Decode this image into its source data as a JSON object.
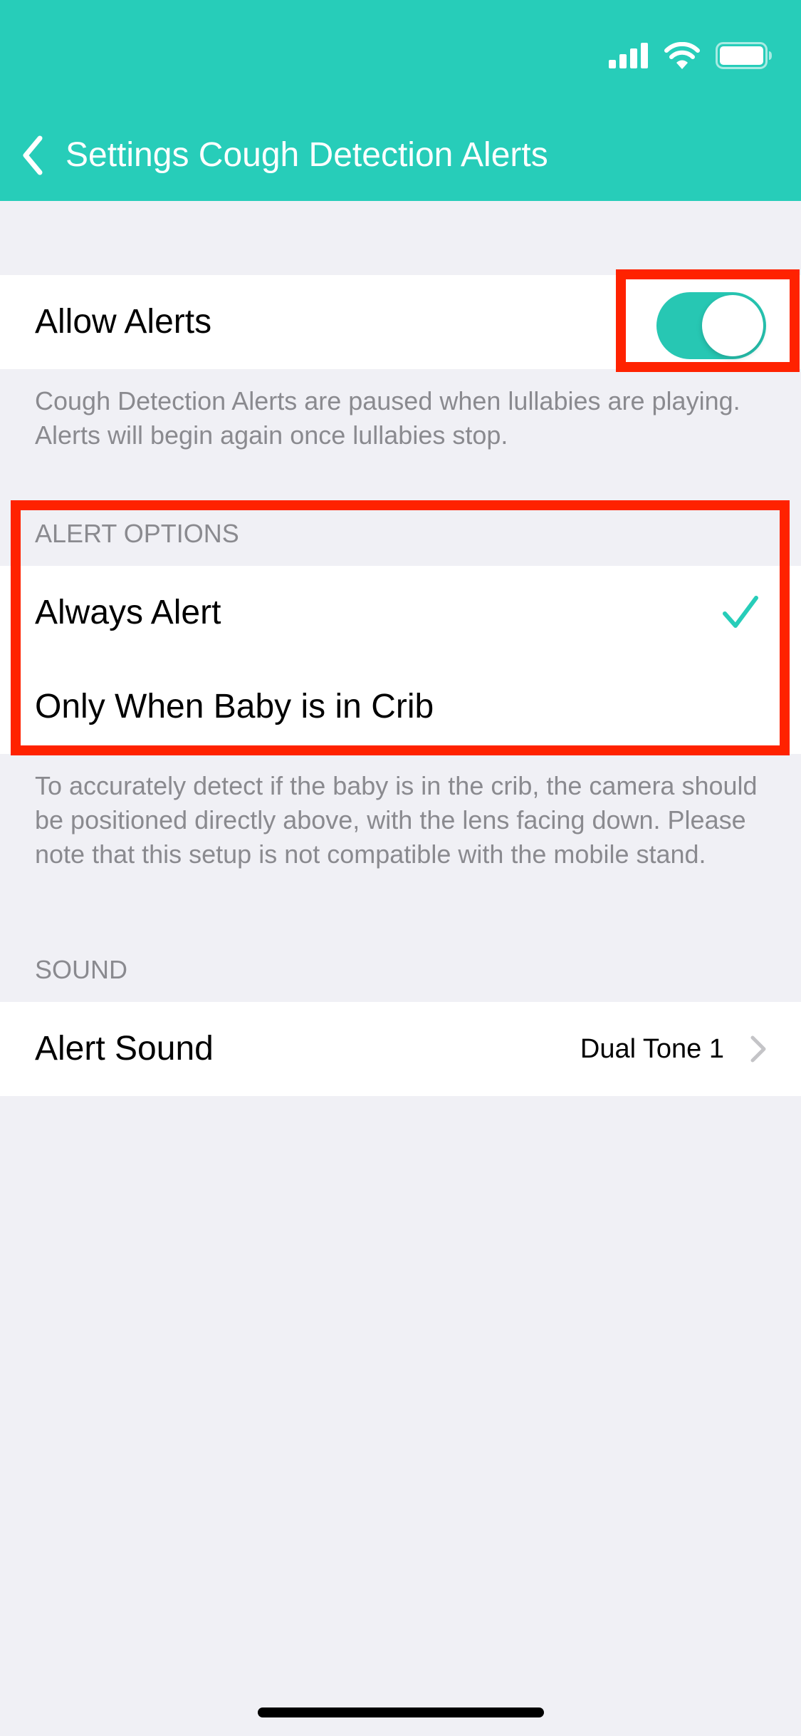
{
  "colors": {
    "accent": "#27CDB9",
    "highlight": "#FF2200",
    "background": "#F0F0F5",
    "secondary_text": "#8A8A8F"
  },
  "status_bar": {
    "icons": [
      "cellular-signal-icon",
      "wifi-icon",
      "battery-icon"
    ]
  },
  "nav": {
    "back_icon": "chevron-left-icon",
    "title": "Settings Cough Detection Alerts"
  },
  "allow_alerts": {
    "label": "Allow Alerts",
    "toggle_on": true,
    "footnote": "Cough Detection Alerts are paused when lullabies are playing. Alerts will begin again once lullabies stop."
  },
  "alert_options": {
    "header": "ALERT OPTIONS",
    "options": [
      {
        "label": "Always Alert",
        "selected": true
      },
      {
        "label": "Only When Baby is in Crib",
        "selected": false
      }
    ],
    "footnote": "To accurately detect if the baby is in the crib, the camera should be positioned directly above, with the lens facing down. Please note that this setup is not compatible with the mobile stand."
  },
  "sound": {
    "header": "SOUND",
    "row_label": "Alert Sound",
    "row_value": "Dual Tone 1"
  }
}
